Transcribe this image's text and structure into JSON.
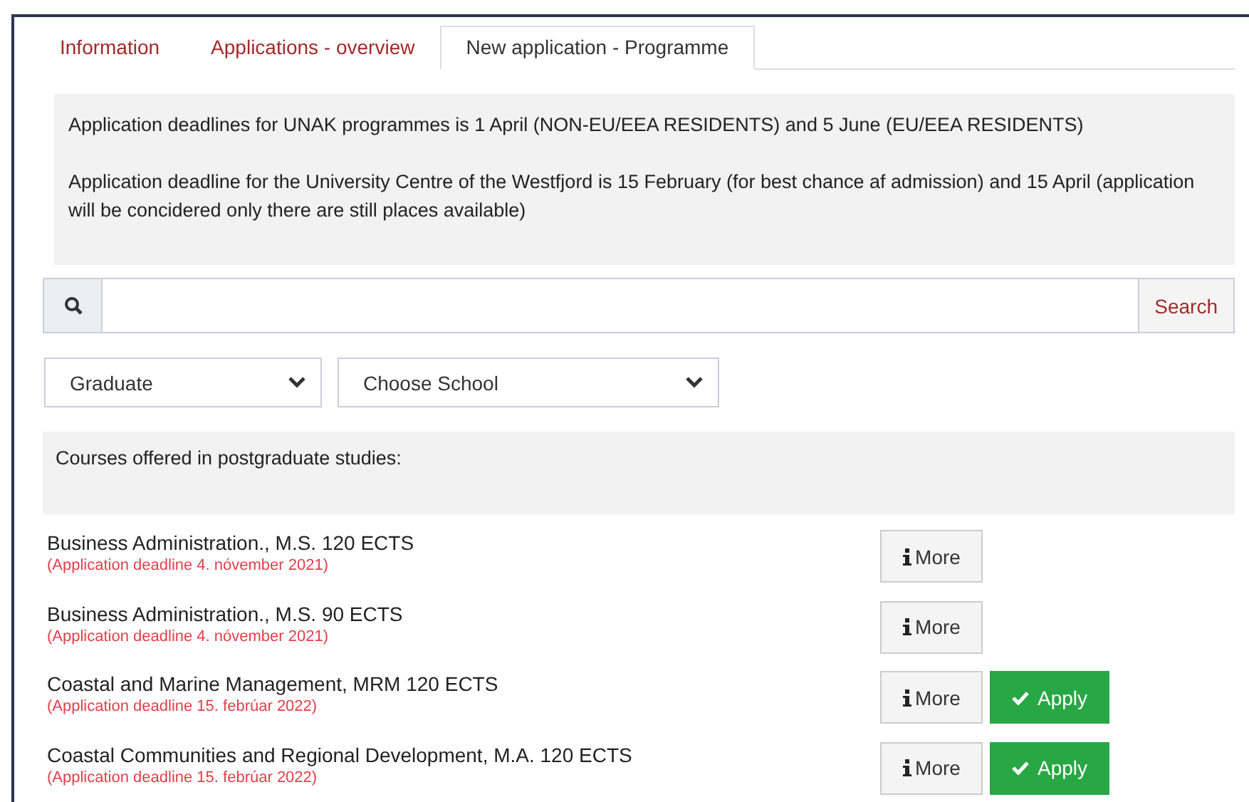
{
  "tabs": [
    {
      "label": "Information",
      "selected": false
    },
    {
      "label": "Applications - overview",
      "selected": false
    },
    {
      "label": "New application - Programme",
      "selected": true
    }
  ],
  "notice": [
    "Application deadlines for UNAK programmes is 1 April (NON-EU/EEA RESIDENTS) and 5 June (EU/EEA RESIDENTS)",
    "Application deadline for the University Centre of the Westfjord is 15 February (for best chance af admission) and 15 April (application will be concidered only there are still places available)"
  ],
  "search": {
    "button": "Search"
  },
  "filters": [
    {
      "value": "Graduate"
    },
    {
      "value": "Choose School"
    }
  ],
  "courses_heading": "Courses offered in postgraduate studies:",
  "courses": [
    {
      "name": "Business Administration., M.S. 120 ECTS",
      "deadline": "(Application deadline 4. nóvember 2021)",
      "more": "More"
    },
    {
      "name": "Business Administration., M.S. 90 ECTS",
      "deadline": "(Application deadline 4. nóvember 2021)",
      "more": "More"
    },
    {
      "name": "Coastal and Marine Management, MRM 120 ECTS",
      "deadline": "(Application deadline 15. febrúar 2022)",
      "more": "More",
      "apply": "Apply"
    },
    {
      "name": "Coastal Communities and Regional Development, M.A. 120 ECTS",
      "deadline": "(Application deadline 15. febrúar 2022)",
      "more": "More",
      "apply": "Apply"
    }
  ]
}
